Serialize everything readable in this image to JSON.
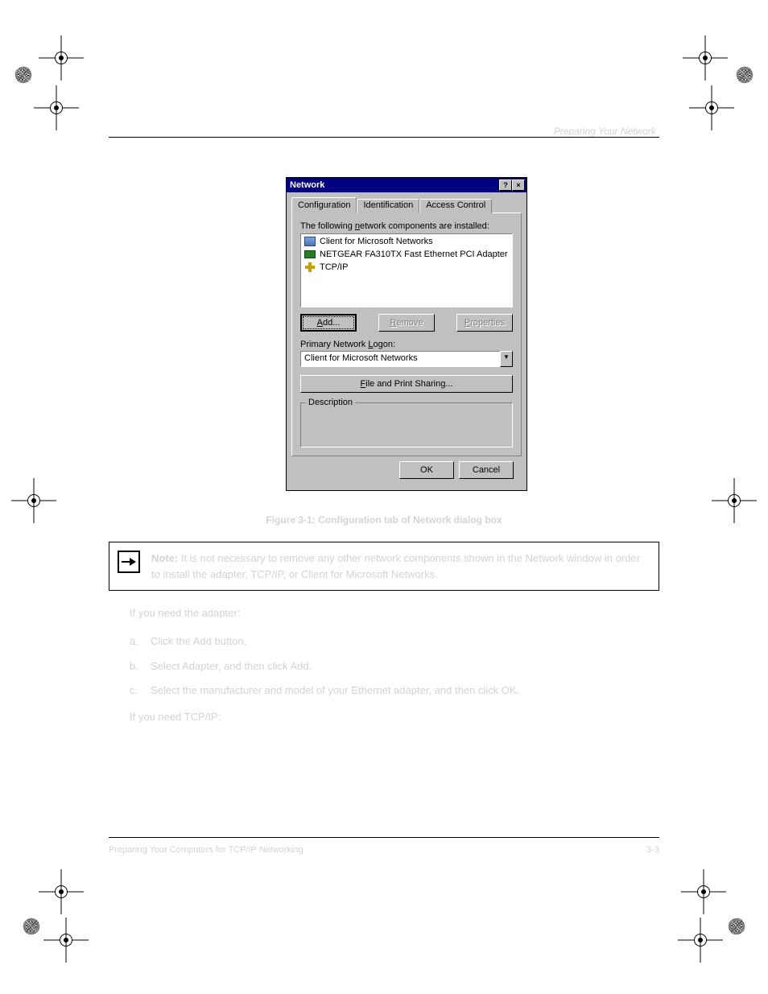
{
  "doc": {
    "header_right": "Preparing Your Network",
    "footer_left": "Preparing Your Computers for TCP/IP Networking",
    "footer_right": "3-3",
    "figure_caption": "Figure 3-1: Configuration tab of Network dialog box"
  },
  "dialog": {
    "title": "Network",
    "tabs": {
      "configuration": "Configuration",
      "identification": "Identification",
      "access_control": "Access Control"
    },
    "list_label_pre": "The following ",
    "list_label_ul": "n",
    "list_label_post": "etwork components are installed:",
    "items": [
      {
        "icon": "client",
        "label": "Client for Microsoft Networks"
      },
      {
        "icon": "adapter",
        "label": "NETGEAR FA310TX Fast Ethernet PCI Adapter"
      },
      {
        "icon": "protocol",
        "label": "TCP/IP"
      }
    ],
    "buttons": {
      "add_ul": "A",
      "add": "dd...",
      "remove_ul": "R",
      "remove": "emove",
      "properties_ul": "P",
      "properties": "roperties"
    },
    "logon_label_pre": "Primary Network ",
    "logon_label_ul": "L",
    "logon_label_post": "ogon:",
    "logon_value": "Client for Microsoft Networks",
    "share_btn_ul": "F",
    "share_btn": "ile and Print Sharing...",
    "description_label": "Description",
    "ok": "OK",
    "cancel": "Cancel"
  },
  "note": {
    "bold": "Note:",
    "text": " It is not necessary to remove any other network components shown in the Network window in order to install the adapter, TCP/IP, or Client for Microsoft Networks."
  },
  "instructions": {
    "intro": "If you need the adapter:",
    "steps": [
      {
        "n": "a.",
        "t": "Click the Add button."
      },
      {
        "n": "b.",
        "t": "Select Adapter, and then click Add."
      },
      {
        "n": "c.",
        "t": "Select the manufacturer and model of your Ethernet adapter, and then click OK."
      }
    ],
    "outro": "If you need TCP/IP:"
  }
}
